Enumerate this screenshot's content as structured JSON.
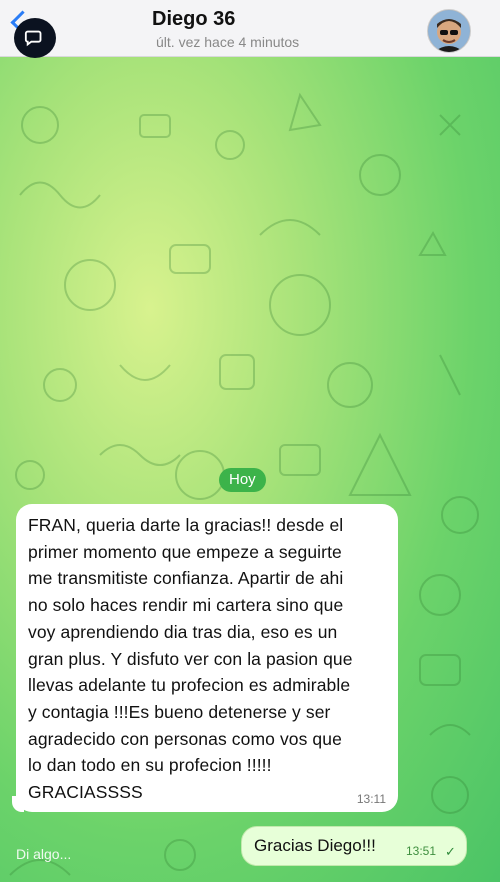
{
  "header": {
    "contact_name": "Diego 36",
    "status": "últ. vez hace 4 minutos"
  },
  "chat": {
    "date_label": "Hoy",
    "messages": [
      {
        "direction": "incoming",
        "text": "FRAN, queria darte la gracias!! desde el\nprimer momento que empeze a seguirte\nme transmitiste confianza. Apartir de ahi\nno solo haces rendir mi cartera sino que\nvoy aprendiendo dia tras dia, eso es un\ngran plus. Y disfuto ver con la pasion que\nllevas adelante tu profecion es admirable\ny contagia !!!Es bueno detenerse y ser\nagradecido con personas como vos que\nlo dan todo en su profecion !!!!!\nGRACIASSSS",
        "time": "13:11"
      },
      {
        "direction": "outgoing",
        "text": "Gracias Diego!!!",
        "time": "13:51",
        "status": "✓"
      }
    ]
  },
  "composer": {
    "placeholder": "Di algo..."
  },
  "colors": {
    "accent_blue": "#2a7df6",
    "date_pill": "#3cb34a",
    "outgoing_bubble": "#e7ffd8"
  }
}
